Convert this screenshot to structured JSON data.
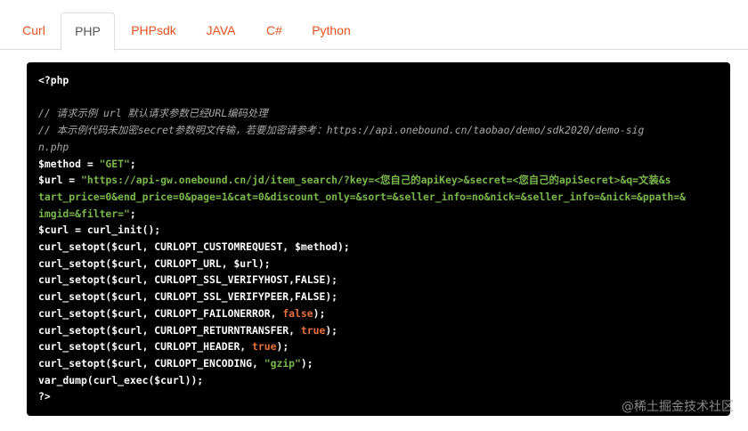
{
  "tabs": [
    {
      "label": "Curl",
      "active": false
    },
    {
      "label": "PHP",
      "active": true
    },
    {
      "label": "PHPsdk",
      "active": false
    },
    {
      "label": "JAVA",
      "active": false
    },
    {
      "label": "C#",
      "active": false
    },
    {
      "label": "Python",
      "active": false
    }
  ],
  "code": {
    "open_tag": "<?php",
    "comment1": "// 请求示例 url 默认请求参数已经URL编码处理",
    "comment2a": "// 本示例代码未加密secret参数明文传输，若要加密请参考：https://api.onebound.cn/taobao/demo/sdk2020/demo-sig",
    "comment2b": "n.php",
    "method_prefix": "$method = ",
    "method_value": "\"GET\"",
    "url_prefix": "$url = ",
    "url_line1": "\"https://api-gw.onebound.cn/jd/item_search/?key=<您自己的apiKey>&secret=<您自己的apiSecret>&q=文装&s",
    "url_line2": "tart_price=0&end_price=0&page=1&cat=0&discount_only=&sort=&seller_info=no&nick=&seller_info=&nick=&ppath=&",
    "url_line3": "imgid=&filter=\"",
    "url_suffix": ";",
    "init": "$curl = curl_init();",
    "opt_customrequest": "curl_setopt($curl, CURLOPT_CUSTOMREQUEST, $method);",
    "opt_url": "curl_setopt($curl, CURLOPT_URL, $url);",
    "opt_verifyhost": "curl_setopt($curl, CURLOPT_SSL_VERIFYHOST,FALSE);",
    "opt_verifypeer": "curl_setopt($curl, CURLOPT_SSL_VERIFYPEER,FALSE);",
    "opt_failonerror_prefix": "curl_setopt($curl, CURLOPT_FAILONERROR, ",
    "opt_failonerror_value": "false",
    "opt_returntransfer_prefix": "curl_setopt($curl, CURLOPT_RETURNTRANSFER, ",
    "opt_returntransfer_value": "true",
    "opt_header_prefix": "curl_setopt($curl, CURLOPT_HEADER, ",
    "opt_header_value": "true",
    "opt_encoding_prefix": "curl_setopt($curl, CURLOPT_ENCODING, ",
    "opt_encoding_value": "\"gzip\"",
    "line_end": ");",
    "dump": "var_dump(curl_exec($curl));",
    "close_tag": "?>"
  },
  "watermark": "@稀土掘金技术社区",
  "colors": {
    "tab_accent": "#e8501c",
    "code_bg": "#000000",
    "string": "#79b84a",
    "keyword": "#e8703a",
    "comment": "#a9a9a9"
  }
}
